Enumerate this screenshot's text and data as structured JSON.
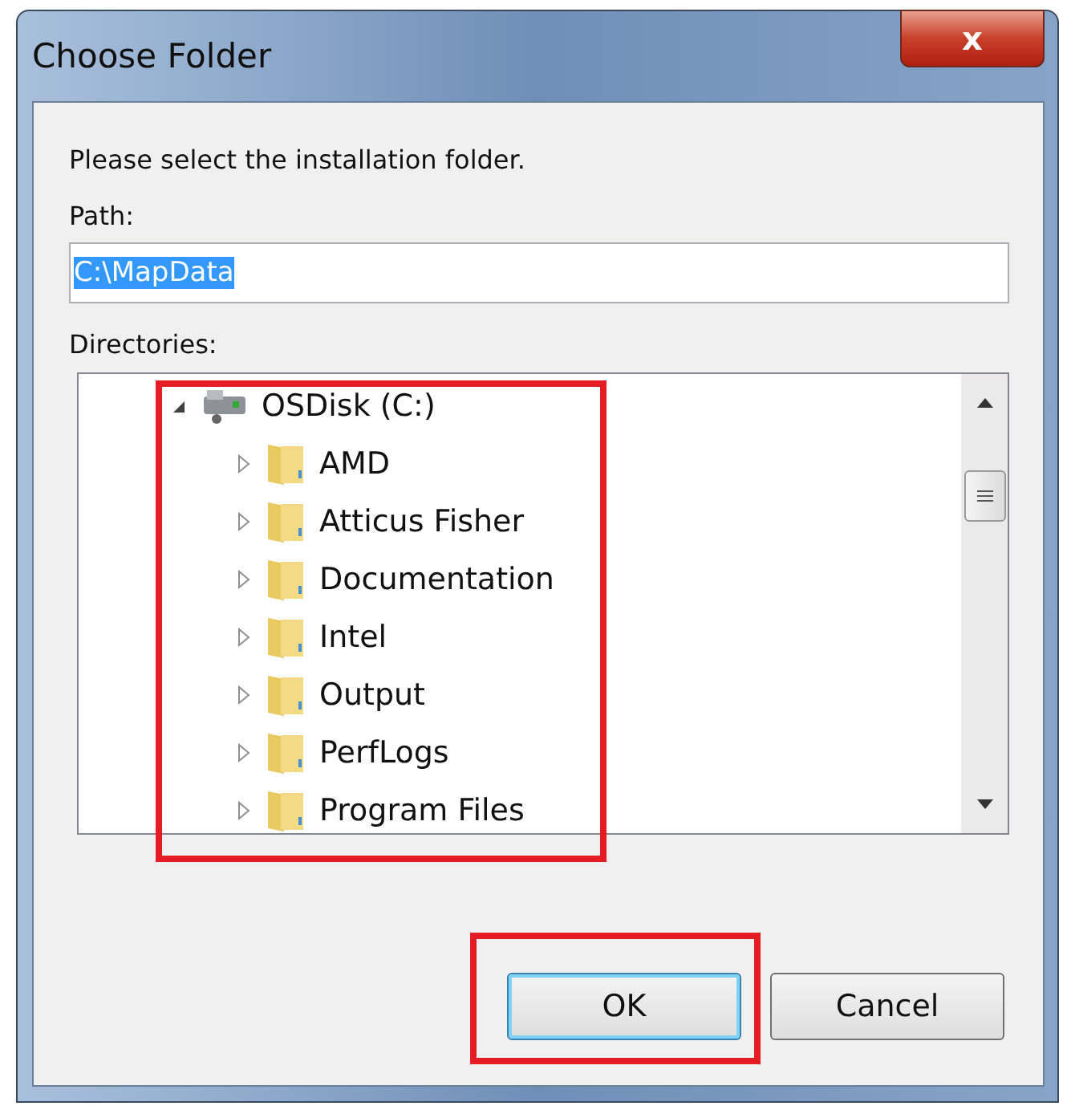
{
  "window": {
    "title": "Choose Folder",
    "close": "x"
  },
  "prompt": "Please select the installation folder.",
  "path": {
    "label": "Path:",
    "value": "C:\\MapData",
    "selected": true
  },
  "directories": {
    "label": "Directories:",
    "highlighted": true,
    "tree": [
      {
        "label": "OSDisk (C:)",
        "kind": "drive",
        "expanded": true,
        "children": [
          {
            "label": "AMD",
            "kind": "folder",
            "expanded": false
          },
          {
            "label": "Atticus Fisher",
            "kind": "folder",
            "expanded": false
          },
          {
            "label": "Documentation",
            "kind": "folder",
            "expanded": false
          },
          {
            "label": "Intel",
            "kind": "folder",
            "expanded": false
          },
          {
            "label": "Output",
            "kind": "folder",
            "expanded": false
          },
          {
            "label": "PerfLogs",
            "kind": "folder",
            "expanded": false
          },
          {
            "label": "Program Files",
            "kind": "folder",
            "expanded": false
          }
        ]
      }
    ]
  },
  "buttons": [
    {
      "label": "OK",
      "default": true,
      "highlighted": true
    },
    {
      "label": "Cancel",
      "default": false,
      "highlighted": false
    }
  ]
}
